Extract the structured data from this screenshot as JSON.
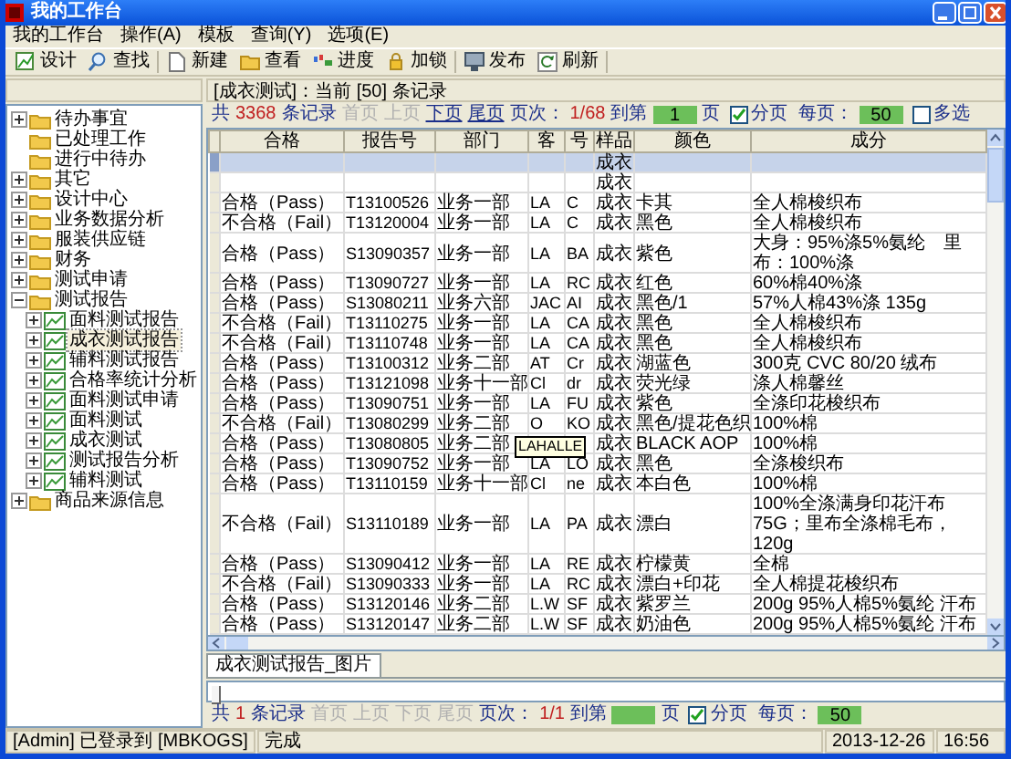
{
  "window": {
    "title": "我的工作台"
  },
  "menu": [
    "我的工作台",
    "操作(A)",
    "模板",
    "查询(Y)",
    "选项(E)"
  ],
  "toolbar": [
    "设计",
    "查找",
    "新建",
    "查看",
    "进度",
    "加锁",
    "发布",
    "刷新"
  ],
  "tree": [
    {
      "label": "待办事宜",
      "expandable": true,
      "expanded": false,
      "kind": "folder",
      "selected": false
    },
    {
      "label": "已处理工作",
      "expandable": false,
      "kind": "folder",
      "selected": false
    },
    {
      "label": "进行中待办",
      "expandable": false,
      "kind": "folder",
      "selected": false
    },
    {
      "label": "其它",
      "expandable": true,
      "expanded": false,
      "kind": "folder",
      "selected": false
    },
    {
      "label": "设计中心",
      "expandable": true,
      "expanded": false,
      "kind": "folder",
      "selected": false
    },
    {
      "label": "业务数据分析",
      "expandable": true,
      "expanded": false,
      "kind": "folder",
      "selected": false
    },
    {
      "label": "服装供应链",
      "expandable": true,
      "expanded": false,
      "kind": "folder",
      "selected": false
    },
    {
      "label": "财务",
      "expandable": true,
      "expanded": false,
      "kind": "folder",
      "selected": false
    },
    {
      "label": "测试申请",
      "expandable": true,
      "expanded": false,
      "kind": "folder",
      "selected": false
    },
    {
      "label": "测试报告",
      "expandable": true,
      "expanded": true,
      "kind": "folder",
      "selected": false,
      "children": [
        {
          "label": "面料测试报告",
          "expandable": true,
          "expanded": false,
          "kind": "report",
          "selected": false
        },
        {
          "label": "成衣测试报告",
          "expandable": true,
          "expanded": false,
          "kind": "report",
          "selected": true
        },
        {
          "label": "辅料测试报告",
          "expandable": true,
          "expanded": false,
          "kind": "report",
          "selected": false
        },
        {
          "label": "合格率统计分析",
          "expandable": true,
          "expanded": false,
          "kind": "report",
          "selected": false
        },
        {
          "label": "面料测试申请",
          "expandable": true,
          "expanded": false,
          "kind": "report",
          "selected": false
        },
        {
          "label": "面料测试",
          "expandable": true,
          "expanded": false,
          "kind": "report",
          "selected": false
        },
        {
          "label": "成衣测试",
          "expandable": true,
          "expanded": false,
          "kind": "report",
          "selected": false
        },
        {
          "label": "测试报告分析",
          "expandable": true,
          "expanded": false,
          "kind": "report",
          "selected": false
        },
        {
          "label": "辅料测试",
          "expandable": true,
          "expanded": false,
          "kind": "report",
          "selected": false
        }
      ]
    },
    {
      "label": "商品来源信息",
      "expandable": true,
      "expanded": false,
      "kind": "folder",
      "selected": false
    }
  ],
  "record_bar": "[成衣测试]：当前 [50] 条记录",
  "pager": {
    "total_label": "共",
    "total": "3368",
    "records_label": "条记录",
    "nav": [
      {
        "label": "首页",
        "disabled": true
      },
      {
        "label": "上页",
        "disabled": true
      },
      {
        "label": "下页",
        "disabled": false
      },
      {
        "label": "尾页",
        "disabled": false
      }
    ],
    "page_label": "页次：",
    "page": "1/68",
    "goto_label": "到第",
    "goto_value": "1",
    "page_unit": "页",
    "paging": {
      "label": "分页",
      "checked": true
    },
    "per_page_label": "每页：",
    "per_page": "50",
    "multi": {
      "label": "多选",
      "checked": false
    }
  },
  "table": {
    "columns": [
      "合格",
      "报告号",
      "部门",
      "客",
      "号",
      "样品",
      "颜色",
      "成分"
    ],
    "rows": [
      {
        "selected": true,
        "cells": [
          null,
          null,
          null,
          null,
          null,
          "成衣",
          null,
          null
        ]
      },
      {
        "selected": false,
        "cells": [
          null,
          null,
          null,
          null,
          null,
          "成衣",
          null,
          null
        ]
      },
      {
        "selected": false,
        "cells": [
          "合格（Pass）",
          "T13100526",
          "业务一部",
          "LA",
          "C",
          "成衣",
          "卡其",
          "全人棉梭织布"
        ]
      },
      {
        "selected": false,
        "cells": [
          "不合格（Fail）",
          "T13120004",
          "业务一部",
          "LA",
          "C",
          "成衣",
          "黑色",
          "全人棉梭织布"
        ]
      },
      {
        "selected": false,
        "cells": [
          "合格（Pass）",
          "S13090357",
          "业务一部",
          "LA",
          "BA",
          "成衣",
          "紫色",
          "大身：95%涤5%氨纶　里布：100%涤"
        ]
      },
      {
        "selected": false,
        "cells": [
          "合格（Pass）",
          "T13090727",
          "业务一部",
          "LA",
          "RC",
          "成衣",
          "红色",
          "60%棉40%涤"
        ]
      },
      {
        "selected": false,
        "cells": [
          "合格（Pass）",
          "S13080211",
          "业务六部",
          "JAC",
          "AI",
          "成衣",
          "黑色/1",
          "57%人棉43%涤 135g"
        ]
      },
      {
        "selected": false,
        "cells": [
          "不合格（Fail）",
          "T13110275",
          "业务一部",
          "LA",
          "CA",
          "成衣",
          "黑色",
          "全人棉梭织布"
        ]
      },
      {
        "selected": false,
        "cells": [
          "不合格（Fail）",
          "T13110748",
          "业务一部",
          "LA",
          "CA",
          "成衣",
          "黑色",
          "全人棉梭织布"
        ]
      },
      {
        "selected": false,
        "cells": [
          "合格（Pass）",
          "T13100312",
          "业务二部",
          "AT",
          "Cr",
          "成衣",
          "湖蓝色",
          "300克 CVC 80/20 绒布"
        ]
      },
      {
        "selected": false,
        "cells": [
          "合格（Pass）",
          "T13121098",
          "业务十一部",
          "Cl",
          "dr",
          "成衣",
          "荧光绿",
          "涤人棉馨丝"
        ]
      },
      {
        "selected": false,
        "cells": [
          "合格（Pass）",
          "T13090751",
          "业务一部",
          "LA",
          "FU",
          "成衣",
          "紫色",
          "全涤印花梭织布"
        ]
      },
      {
        "selected": false,
        "cells": [
          "不合格（Fail）",
          "T13080299",
          "业务二部",
          "O",
          "KO",
          "成衣",
          "黑色/提花色织",
          "100%棉"
        ]
      },
      {
        "selected": false,
        "cells": [
          "合格（Pass）",
          "T13080805",
          "业务二部",
          null,
          null,
          "成衣",
          "BLACK AOP",
          "100%棉"
        ]
      },
      {
        "selected": false,
        "cells": [
          "合格（Pass）",
          "T13090752",
          "业务一部",
          "LA",
          "LO",
          "成衣",
          "黑色",
          "全涤梭织布"
        ]
      },
      {
        "selected": false,
        "cells": [
          "合格（Pass）",
          "T13110159",
          "业务十一部",
          "Cl",
          "ne",
          "成衣",
          "本白色",
          "100%棉"
        ]
      },
      {
        "selected": false,
        "cells": [
          "不合格（Fail）",
          "S13110189",
          "业务一部",
          "LA",
          "PA",
          "成衣",
          "漂白",
          "100%全涤满身印花汗布75G；里布全涤棉毛布，120g"
        ]
      },
      {
        "selected": false,
        "cells": [
          "合格（Pass）",
          "S13090412",
          "业务一部",
          "LA",
          "RE",
          "成衣",
          "柠檬黄",
          "全棉"
        ]
      },
      {
        "selected": false,
        "cells": [
          "不合格（Fail）",
          "S13090333",
          "业务一部",
          "LA",
          "RC",
          "成衣",
          "漂白+印花",
          "全人棉提花梭织布"
        ]
      },
      {
        "selected": false,
        "cells": [
          "合格（Pass）",
          "S13120146",
          "业务二部",
          "L.W",
          "SF",
          "成衣",
          "紫罗兰",
          "200g 95%人棉5%氨纶 汗布"
        ]
      },
      {
        "selected": false,
        "cells": [
          "合格（Pass）",
          "S13120147",
          "业务二部",
          "L.W",
          "SF",
          "成衣",
          "奶油色",
          "200g 95%人棉5%氨纶 汗布"
        ]
      }
    ]
  },
  "tooltip": "LAHALLE",
  "bottom_tab": {
    "label": "成衣测试报告_图片",
    "selected": true
  },
  "bottom_pager": {
    "total_label": "共",
    "total": "1",
    "records_label": "条记录",
    "nav": [
      {
        "label": "首页",
        "disabled": true
      },
      {
        "label": "上页",
        "disabled": true
      },
      {
        "label": "下页",
        "disabled": true
      },
      {
        "label": "尾页",
        "disabled": true
      }
    ],
    "page_label": "页次：",
    "page": "1/1",
    "goto_label": "到第",
    "page_unit": "页",
    "paging": {
      "label": "分页",
      "checked": true
    },
    "per_page_label": "每页：",
    "per_page": "50"
  },
  "status_bar": [
    "[Admin] 已登录到 [MBKOGS]",
    "完成",
    "2013-12-26",
    "16:56"
  ]
}
